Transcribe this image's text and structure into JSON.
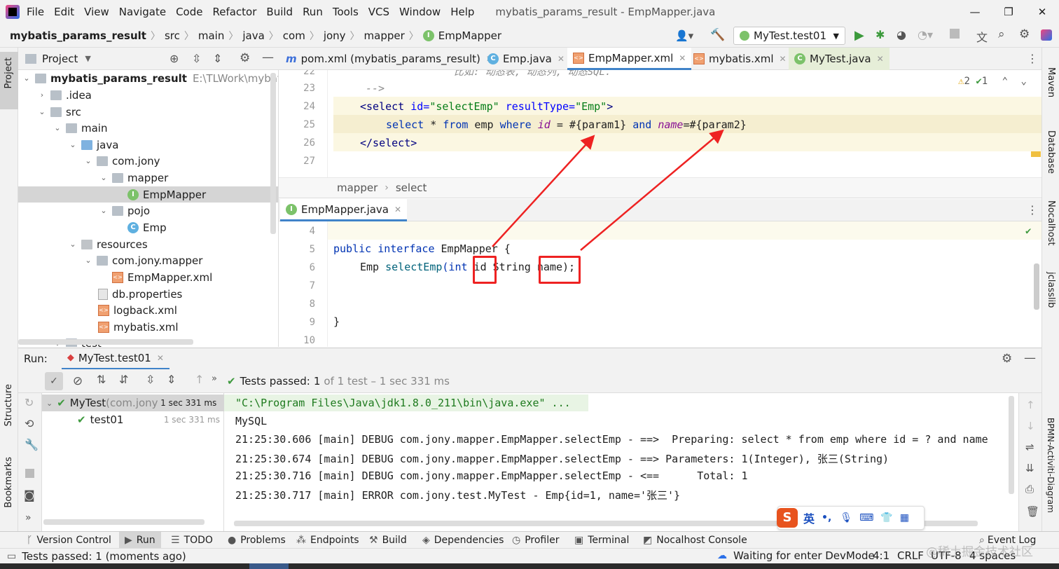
{
  "menubar": {
    "items": [
      "File",
      "Edit",
      "View",
      "Navigate",
      "Code",
      "Refactor",
      "Build",
      "Run",
      "Tools",
      "VCS",
      "Window",
      "Help"
    ],
    "title": "mybatis_params_result - EmpMapper.java"
  },
  "navbar": {
    "crumbs": [
      "mybatis_params_result",
      "src",
      "main",
      "java",
      "com",
      "jony",
      "mapper",
      "EmpMapper"
    ],
    "run_config": "MyTest.test01"
  },
  "left_stripe": {
    "project": "Project",
    "structure": "Structure",
    "bookmarks": "Bookmarks"
  },
  "right_stripe": {
    "maven": "Maven",
    "database": "Database",
    "nocalhost": "Nocalhost",
    "jclasslib": "jclasslib",
    "bpmn": "BPMN-Activiti-Diagram"
  },
  "project": {
    "header": "Project",
    "root_name": "mybatis_params_result",
    "root_path": "E:\\TLWork\\mybatis\\my",
    "nodes": [
      ".idea",
      "src",
      "main",
      "java",
      "com.jony",
      "mapper",
      "EmpMapper",
      "pojo",
      "Emp",
      "resources",
      "com.jony.mapper",
      "EmpMapper.xml",
      "db.properties",
      "logback.xml",
      "mybatis.xml",
      "test"
    ]
  },
  "editor_tabs": [
    "pom.xml (mybatis_params_result)",
    "Emp.java",
    "EmpMapper.xml",
    "mybatis.xml",
    "MyTest.java"
  ],
  "editor1": {
    "line_numbers": [
      "22",
      "23",
      "24",
      "25",
      "26",
      "27"
    ],
    "line22": "比如: 动态表, 动态列, 动态SQL.",
    "line23": "-->",
    "line24": {
      "open": "<select ",
      "id_attr": "id=",
      "id_val": "\"selectEmp\"",
      "rt_attr": " resultType=",
      "rt_val": "\"Emp\"",
      "close": ">"
    },
    "line25": {
      "select": "select",
      "star": " * ",
      "from": "from",
      "emp": " emp ",
      "where": "where",
      "id": "id",
      "eq1": " = #{param1} ",
      "and": "and",
      "name": "name",
      "eq2": "=#{param2}"
    },
    "line26": "</select>",
    "inspections": {
      "warnings": "2",
      "ok": "1"
    },
    "breadcrumb": [
      "mapper",
      "select"
    ]
  },
  "editor2": {
    "tab": "EmpMapper.java",
    "line_numbers": [
      "4",
      "5",
      "6",
      "7",
      "8",
      "9",
      "10"
    ],
    "line5": {
      "public": "public",
      "interface": " interface",
      "name": " EmpMapper {"
    },
    "line6": {
      "emp": "Emp ",
      "method": "selectEmp",
      "int": "(int",
      "id": " id",
      "string": " String",
      "name": " name",
      "end": ");"
    },
    "line9": "}"
  },
  "run": {
    "label": "Run:",
    "tab": "MyTest.test01",
    "status_prefix": "Tests passed: ",
    "status_count": "1",
    "status_rest": " of 1 test – 1 sec 331 ms",
    "tree": [
      {
        "name": "MyTest",
        "pkg": " (com.jony.t",
        "time": "1 sec 331 ms"
      },
      {
        "name": "test01",
        "time": "1 sec 331 ms"
      }
    ],
    "console": [
      "\"C:\\Program Files\\Java\\jdk1.8.0_211\\bin\\java.exe\" ...",
      "MySQL",
      "21:25:30.606 [main] DEBUG com.jony.mapper.EmpMapper.selectEmp - ==>  Preparing: select * from emp where id = ? and name",
      "21:25:30.674 [main] DEBUG com.jony.mapper.EmpMapper.selectEmp - ==> Parameters: 1(Integer), 张三(String)",
      "21:25:30.716 [main] DEBUG com.jony.mapper.EmpMapper.selectEmp - <==      Total: 1",
      "21:25:30.717 [main] ERROR com.jony.test.MyTest - Emp{id=1, name='张三'}"
    ]
  },
  "ime": {
    "lang": "英"
  },
  "tool_windows": [
    "Version Control",
    "Run",
    "TODO",
    "Problems",
    "Endpoints",
    "Build",
    "Dependencies",
    "Profiler",
    "Terminal",
    "Nocalhost Console",
    "Event Log"
  ],
  "statusbar": {
    "left": "Tests passed: 1 (moments ago)",
    "devmode": "Waiting for enter DevMode",
    "position": "4:1",
    "line_sep": "CRLF",
    "encoding": "UTF-8",
    "indent": "4 spaces",
    "watermark": "@稀土掘金技术社区"
  },
  "colors": {
    "accent": "#4083c9",
    "annotation": "#e22222",
    "highlight": "#fbf7e2",
    "pass": "#3f9a3f"
  }
}
